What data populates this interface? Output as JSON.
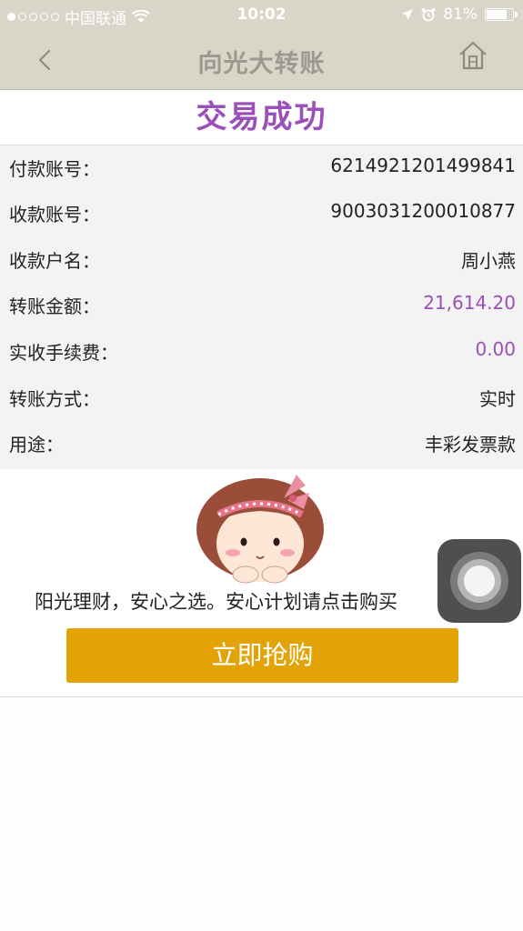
{
  "status_bar": {
    "carrier": "中国联通",
    "time": "10:02",
    "battery": "81%",
    "signal_dots_filled": 1,
    "signal_dots_total": 5,
    "battery_level": 0.81
  },
  "nav": {
    "title": "向光大转账",
    "back_icon": "chevron-left-icon",
    "home_icon": "home-icon"
  },
  "result": {
    "title": "交易成功"
  },
  "details": [
    {
      "label": "付款账号：",
      "value": "6214921201499841"
    },
    {
      "label": "收款账号：",
      "value": "9003031200010877"
    },
    {
      "label": "收款户名：",
      "value": "周小燕"
    },
    {
      "label": "转账金额：",
      "value": "21,614.20"
    },
    {
      "label": "实收手续费：",
      "value": "0.00"
    },
    {
      "label": "转账方式：",
      "value": "实时"
    },
    {
      "label": "用途：",
      "value": "丰彩发票款"
    }
  ],
  "promo": {
    "text": "阳光理财，安心之选。安心计划请点击购买",
    "button": "立即抢购"
  },
  "colors": {
    "accent_purple": "#9b4fb8",
    "button_gold": "#e3a307",
    "nav_bg": "#d9d5c9"
  }
}
